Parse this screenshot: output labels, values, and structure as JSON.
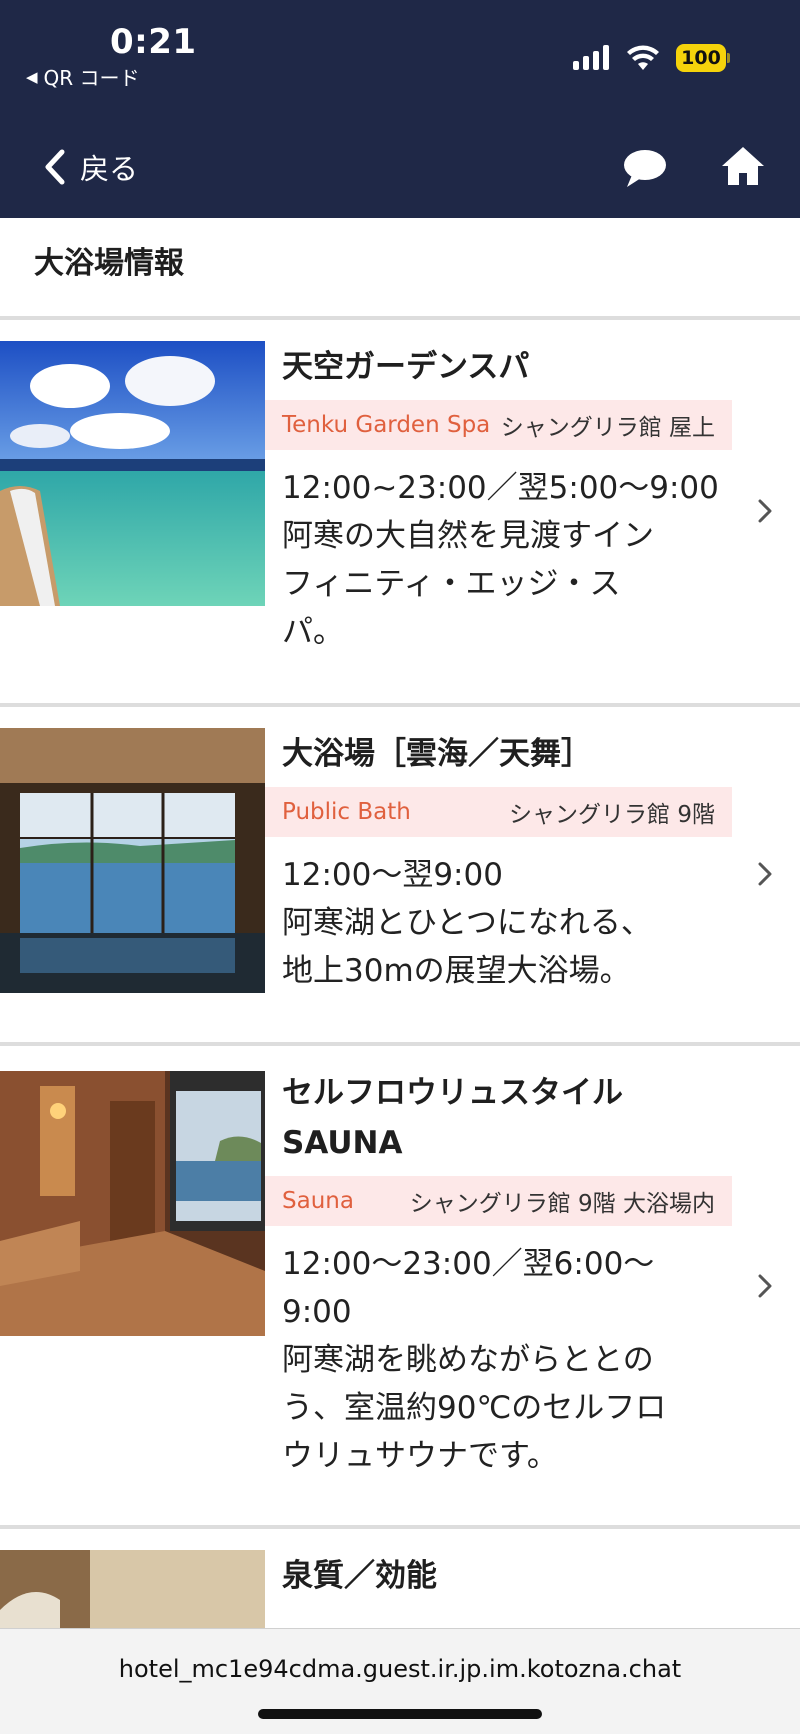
{
  "status_bar": {
    "time": "0:21",
    "back_app_label": "QR コード",
    "battery": "100"
  },
  "nav": {
    "back_label": "戻る"
  },
  "page": {
    "title": "大浴場情報"
  },
  "items": [
    {
      "title": "天空ガーデンスパ",
      "tag_en": "Tenku Garden Spa",
      "location": "シャングリラ館 屋上",
      "hours": "12:00~23:00／翌5:00〜9:00",
      "desc_lines": [
        "阿寒の大自然を見渡すイン",
        "フィニティ・エッジ・ス",
        "パ。"
      ]
    },
    {
      "title": "大浴場［雲海／天舞］",
      "tag_en": "Public Bath",
      "location": "シャングリラ館 9階",
      "hours": "12:00〜翌9:00",
      "desc_lines": [
        "阿寒湖とひとつになれる、",
        "地上30mの展望大浴場。"
      ]
    },
    {
      "title_lines": [
        "セルフロウリュスタイル",
        "SAUNA"
      ],
      "tag_en": "Sauna",
      "location": "シャングリラ館 9階 大浴場内",
      "hours_lines": [
        "12:00〜23:00／翌6:00〜",
        "9:00"
      ],
      "desc_lines": [
        "阿寒湖を眺めながらととの",
        "う、室温約90℃のセルフロ",
        "ウリュサウナです。"
      ]
    },
    {
      "title": "泉質／効能"
    }
  ],
  "url_bar": {
    "url": "hotel_mc1e94cdma.guest.ir.jp.im.kotozna.chat"
  },
  "colors": {
    "nav_bg": "#1f2847",
    "tag_bg": "#fde8e8",
    "tag_accent": "#e0603e",
    "battery": "#f5d30b"
  },
  "icons": [
    "chevron-left-icon",
    "chat-bubble-icon",
    "home-icon",
    "chevron-right-icon",
    "wifi-icon",
    "signal-icon",
    "battery-icon"
  ]
}
